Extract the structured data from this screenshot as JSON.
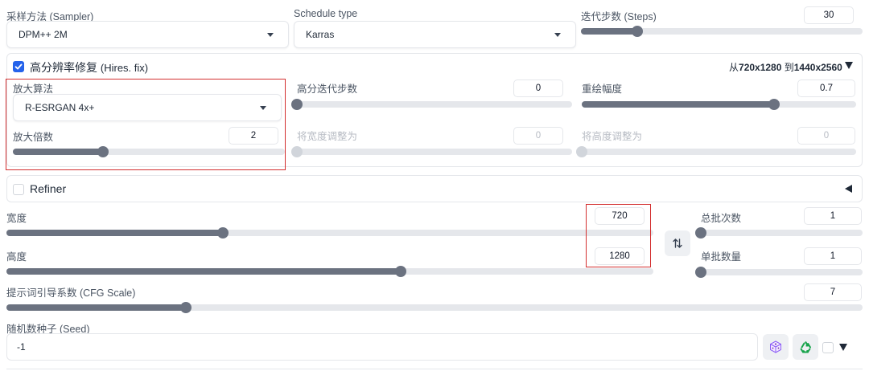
{
  "sampler": {
    "label": "采样方法 (Sampler)",
    "value": "DPM++ 2M"
  },
  "schedule": {
    "label": "Schedule type",
    "value": "Karras"
  },
  "steps": {
    "label": "迭代步数 (Steps)",
    "value": "30",
    "fraction": 0.2
  },
  "hires": {
    "title_zh": "高分辨率修复",
    "title_en": "(Hires. fix)",
    "summary_prefix": "从",
    "summary_from": "720x1280",
    "summary_mid": " 到",
    "summary_to": "1440x2560",
    "upscaler": {
      "label": "放大算法",
      "value": "R-ESRGAN 4x+"
    },
    "hires_steps": {
      "label": "高分迭代步数",
      "value": "0",
      "fraction": 0
    },
    "denoise": {
      "label": "重绘幅度",
      "value": "0.7",
      "fraction": 0.7
    },
    "upscale_by": {
      "label": "放大倍数",
      "value": "2",
      "fraction": 0.33
    },
    "resize_width": {
      "label": "将宽度调整为",
      "value": "0",
      "fraction": 0
    },
    "resize_height": {
      "label": "将高度调整为",
      "value": "0",
      "fraction": 0
    }
  },
  "refiner": {
    "label": "Refiner"
  },
  "width": {
    "label": "宽度",
    "value": "720",
    "fraction": 0.335
  },
  "height": {
    "label": "高度",
    "value": "1280",
    "fraction": 0.609
  },
  "batch_count": {
    "label": "总批次数",
    "value": "1",
    "fraction": 0
  },
  "batch_size": {
    "label": "单批数量",
    "value": "1",
    "fraction": 0
  },
  "cfg": {
    "label": "提示词引导系数 (CFG Scale)",
    "value": "7",
    "fraction": 0.21
  },
  "seed": {
    "label": "随机数种子 (Seed)",
    "value": "-1"
  },
  "icons": {
    "swap": "swap-icon",
    "dice": "dice-icon",
    "recycle": "recycle-icon"
  },
  "colors": {
    "accent": "#2563eb",
    "highlight": "#d32f2f",
    "slider": "#6b7280"
  }
}
